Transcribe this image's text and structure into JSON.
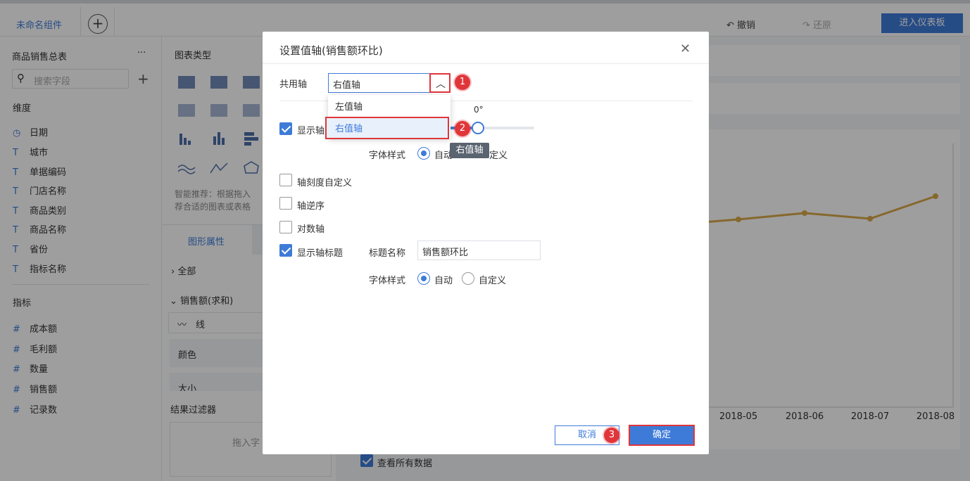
{
  "topbar": {
    "component_name": "未命名组件",
    "undo_label": "撤销",
    "redo_label": "还原",
    "dashboard_button": "进入仪表板"
  },
  "left_panel": {
    "dataset_title": "商品销售总表",
    "more": "···",
    "search_placeholder": "搜索字段",
    "dimensions_header": "维度",
    "dimensions": [
      "日期",
      "城市",
      "单据编码",
      "门店名称",
      "商品类别",
      "商品名称",
      "省份",
      "指标名称"
    ],
    "measures_header": "指标",
    "measures": [
      "成本额",
      "毛利额",
      "数量",
      "销售额",
      "记录数"
    ]
  },
  "middle_panel": {
    "chart_type_header": "图表类型",
    "smart_hint_line1": "智能推荐：根据拖入",
    "smart_hint_line2": "荐合适的图表或表格",
    "tab_graph_props": "图形属性",
    "all_label": "全部",
    "measure_group": "销售额(求和)",
    "line_label": "线",
    "color_label": "颜色",
    "size_label": "大小",
    "filter_header": "结果过滤器",
    "drag_hint": "拖入字"
  },
  "main_area": {
    "x_ticks": [
      "2018-05",
      "2018-06",
      "2018-07",
      "2018-08"
    ],
    "view_all_label": "查看所有数据"
  },
  "dialog": {
    "title": "设置值轴(销售额环比)",
    "shared_axis_label": "共用轴",
    "shared_axis_value": "右值轴",
    "dropdown_options": [
      "左值轴",
      "右值轴"
    ],
    "tooltip_text": "右值轴",
    "rotation_value": "0°",
    "show_axis_label": "显示轴",
    "font_style_label": "字体样式",
    "auto_label": "自动",
    "custom_label": "自定义",
    "custom_label_partial": "定义",
    "auto_partial": "自动",
    "custom_scale_label": "轴刻度自定义",
    "reverse_axis_label": "轴逆序",
    "log_axis_label": "对数轴",
    "show_axis_title_label": "显示轴标题",
    "title_name_label": "标题名称",
    "title_name_value": "销售额环比",
    "cancel_button": "取消",
    "ok_button": "确定",
    "badges": [
      "1",
      "2",
      "3"
    ]
  },
  "colors": {
    "accent": "#3e7bd8",
    "highlight": "#e0363a",
    "line_series": "#d9a84a"
  }
}
